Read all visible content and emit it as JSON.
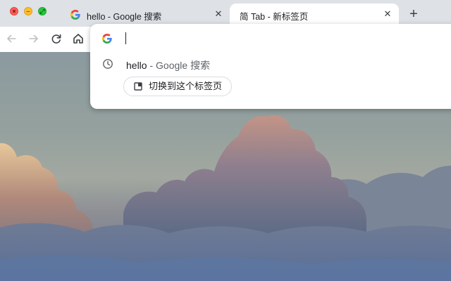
{
  "window": {
    "controls": [
      "close",
      "minimize",
      "fullscreen"
    ]
  },
  "tabs": [
    {
      "title": "hello - Google 搜索",
      "favicon": "google-icon",
      "active": false
    },
    {
      "title": "简 Tab - 新标签页",
      "active": true
    }
  ],
  "toolbar": {
    "buttons": [
      "back-icon",
      "forward-icon",
      "reload-icon",
      "home-icon"
    ]
  },
  "omnibox": {
    "engine_icon": "google-icon",
    "value": "",
    "suggestion": {
      "query": "hello",
      "separator": " - ",
      "engine": "Google 搜索",
      "icon": "history-clock-icon"
    },
    "switch_tab_label": "切换到这个标签页"
  },
  "colors": {
    "tabstrip": "#dee1e6",
    "active_tab": "#ffffff",
    "text": "#202124",
    "muted_text": "#5f6368"
  }
}
